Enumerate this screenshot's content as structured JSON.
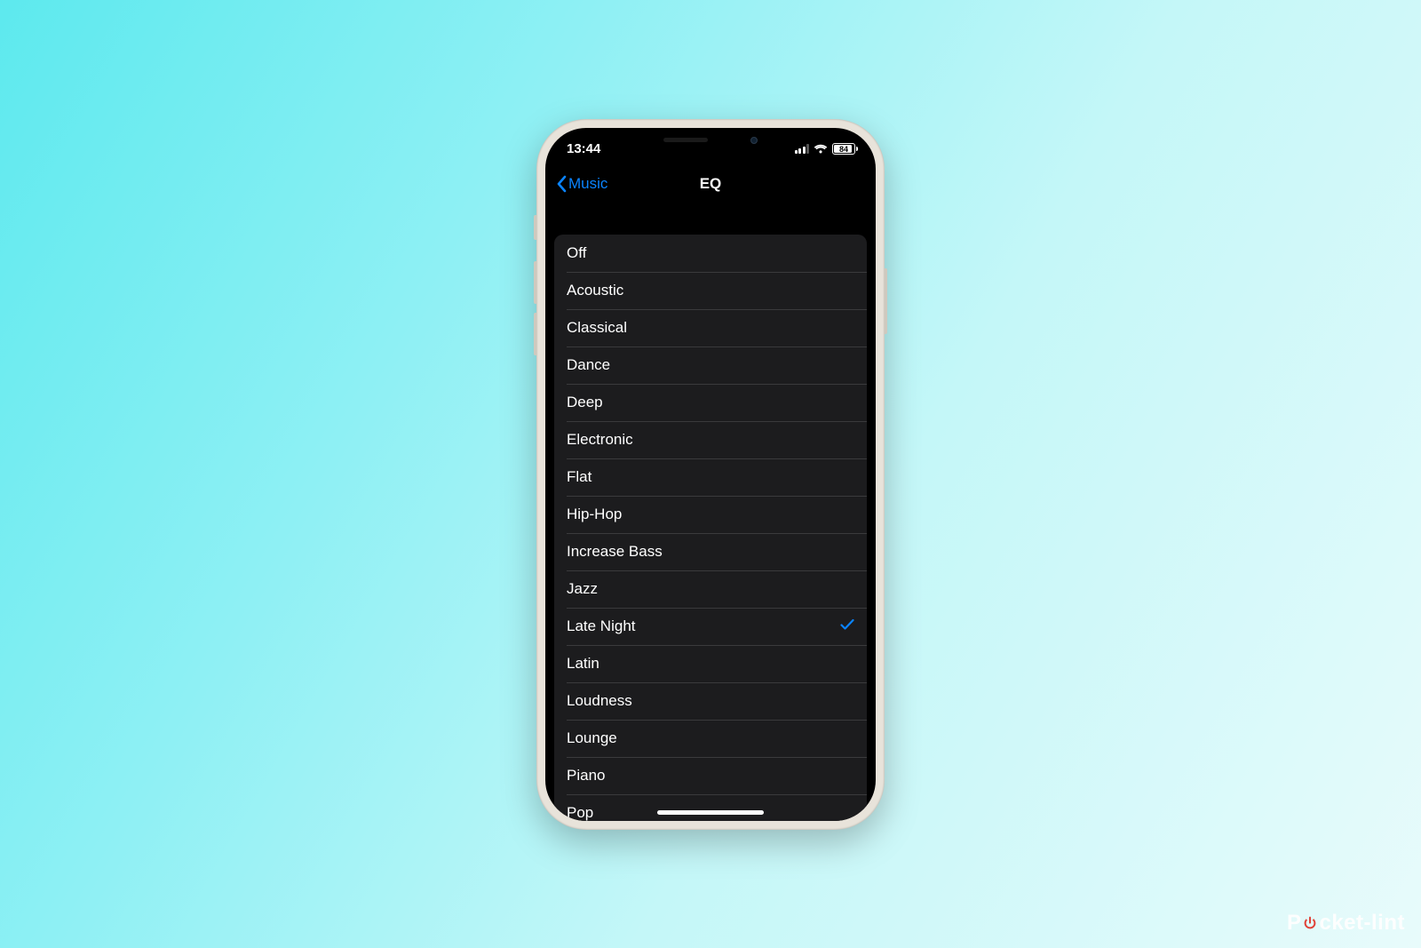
{
  "status": {
    "time": "13:44",
    "battery_pct": "84"
  },
  "nav": {
    "back_label": "Music",
    "title": "EQ"
  },
  "eq": {
    "selected_index": 10,
    "options": [
      {
        "label": "Off"
      },
      {
        "label": "Acoustic"
      },
      {
        "label": "Classical"
      },
      {
        "label": "Dance"
      },
      {
        "label": "Deep"
      },
      {
        "label": "Electronic"
      },
      {
        "label": "Flat"
      },
      {
        "label": "Hip-Hop"
      },
      {
        "label": "Increase Bass"
      },
      {
        "label": "Jazz"
      },
      {
        "label": "Late Night"
      },
      {
        "label": "Latin"
      },
      {
        "label": "Loudness"
      },
      {
        "label": "Lounge"
      },
      {
        "label": "Piano"
      },
      {
        "label": "Pop"
      }
    ]
  },
  "watermark": {
    "prefix": "P",
    "suffix": "cket-lint"
  },
  "colors": {
    "accent": "#0a84ff",
    "list_bg": "#1c1c1e",
    "divider": "#3a3a3c"
  }
}
